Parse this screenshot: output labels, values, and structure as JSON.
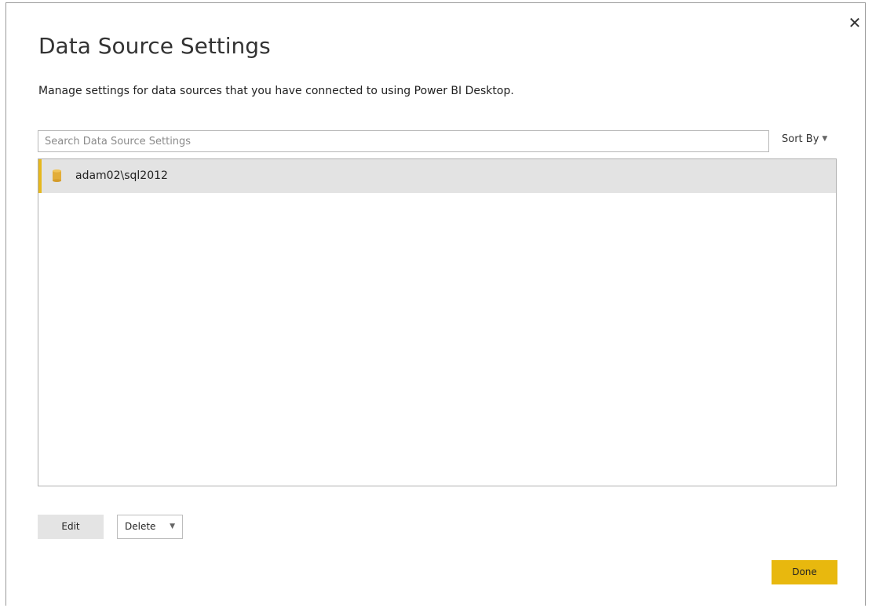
{
  "dialog": {
    "title": "Data Source Settings",
    "description": "Manage settings for data sources that you have connected to using Power BI Desktop.",
    "close_glyph": "✕"
  },
  "search": {
    "placeholder": "Search Data Source Settings",
    "value": ""
  },
  "sort": {
    "label": "Sort By",
    "caret": "▼"
  },
  "data_sources": [
    {
      "label": "adam02\\sql2012",
      "icon": "database-icon",
      "selected": true
    }
  ],
  "buttons": {
    "edit": "Edit",
    "delete": "Delete",
    "delete_caret": "▼",
    "done": "Done"
  },
  "colors": {
    "accent_yellow": "#e8b80e",
    "selection_bg": "#e3e3e3",
    "selection_bar": "#e6b81e"
  }
}
